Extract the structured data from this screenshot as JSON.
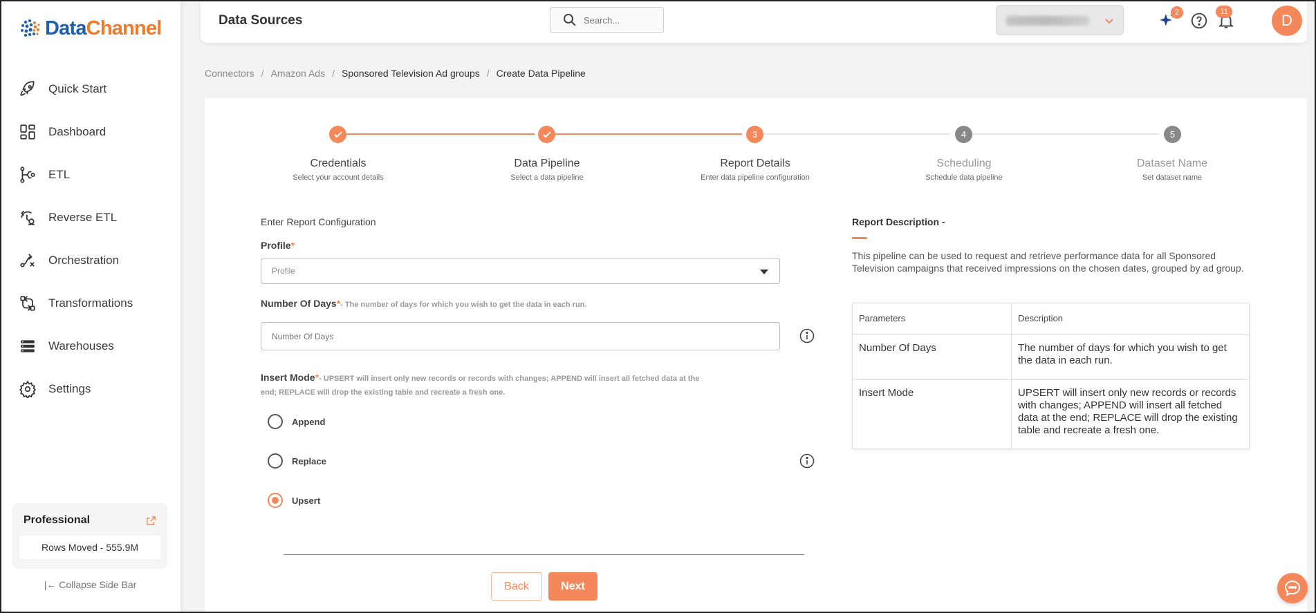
{
  "brand": {
    "logo_prefix": "Data",
    "logo_suffix": "Channel",
    "primary_color": "#1f5fae",
    "accent_color": "#f4885a"
  },
  "sidebar": {
    "items": [
      {
        "label": "Quick Start",
        "icon": "rocket-icon"
      },
      {
        "label": "Dashboard",
        "icon": "dashboard-icon"
      },
      {
        "label": "ETL",
        "icon": "etl-icon"
      },
      {
        "label": "Reverse ETL",
        "icon": "reverse-etl-icon"
      },
      {
        "label": "Orchestration",
        "icon": "orchestration-icon"
      },
      {
        "label": "Transformations",
        "icon": "transformations-icon"
      },
      {
        "label": "Warehouses",
        "icon": "warehouses-icon"
      },
      {
        "label": "Settings",
        "icon": "gear-icon"
      }
    ],
    "plan": {
      "name": "Professional",
      "rows_moved": "Rows Moved - 555.9M"
    },
    "collapse_label": "Collapse Side Bar"
  },
  "header": {
    "title": "Data Sources",
    "search_placeholder": "Search...",
    "sparkle_badge": "2",
    "notification_badge": "11",
    "avatar_initial": "D"
  },
  "breadcrumb": {
    "items": [
      "Connectors",
      "Amazon Ads",
      "Sponsored Television Ad groups",
      "Create Data Pipeline"
    ],
    "separator": "/"
  },
  "stepper": {
    "steps": [
      {
        "number": "1",
        "title": "Credentials",
        "subtitle": "Select your account details",
        "state": "done"
      },
      {
        "number": "2",
        "title": "Data Pipeline",
        "subtitle": "Select a data pipeline",
        "state": "done"
      },
      {
        "number": "3",
        "title": "Report Details",
        "subtitle": "Enter data pipeline configuration",
        "state": "active"
      },
      {
        "number": "4",
        "title": "Scheduling",
        "subtitle": "Schedule data pipeline",
        "state": "pending"
      },
      {
        "number": "5",
        "title": "Dataset Name",
        "subtitle": "Set dataset name",
        "state": "pending"
      }
    ]
  },
  "form": {
    "section_title": "Enter Report Configuration",
    "profile_label": "Profile",
    "profile_placeholder": "Profile",
    "days_label": "Number Of Days",
    "days_hint": "- The number of days for which you wish to get the data in each run.",
    "days_placeholder": "Number Of Days",
    "insert_label": "Insert Mode",
    "insert_hint_line1": "- UPSERT will insert only new records or records with changes; APPEND will insert all fetched data at the",
    "insert_hint_line2": "end; REPLACE will drop the existing table and recreate a fresh one.",
    "required_mark": "*",
    "options": [
      "Append",
      "Replace",
      "Upsert"
    ],
    "selected_option": "Upsert",
    "back_label": "Back",
    "next_label": "Next"
  },
  "description": {
    "title": "Report Description -",
    "text": "This pipeline can be used to request and retrieve performance data for all Sponsored Television campaigns that received impressions on the chosen dates, grouped by ad group.",
    "table": {
      "headers": [
        "Parameters",
        "Description"
      ],
      "rows": [
        [
          "Number Of Days",
          "The number of days for which you wish to get the data in each run."
        ],
        [
          "Insert Mode",
          "UPSERT will insert only new records or records with changes; APPEND will insert all fetched data at the end; REPLACE will drop the existing table and recreate a fresh one."
        ]
      ]
    }
  }
}
